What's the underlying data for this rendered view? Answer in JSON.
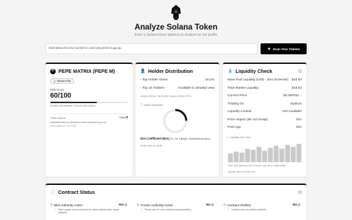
{
  "header": {
    "title": "Analyze Solana Token",
    "subtitle": "Enter a Solana token address to analyze its risk profile"
  },
  "search": {
    "value": "B8ZkNHN4k5SoYAeJ3bHS5FGrLUWhYpKy9DDSC5ugpump",
    "button_label": "Scan Your Tokens"
  },
  "token_card": {
    "name": "PEPE MATRIX (PEPE M)",
    "risk_badge": "Medium Risk",
    "risk_score_label": "Risk Score",
    "risk_score": "60/100",
    "risk_fraction": 0.6,
    "risk_note": "Medium risk detected. Proceed with caution.",
    "address_label": "Token Address",
    "copy_label": "Copy",
    "address": "B8ZkNHN4k5SoYAeJ3bHS5FGrLUWhYpKy9DDSC5ugpump",
    "created": "Data created on 3.12 10:48"
  },
  "holder_card": {
    "title": "Holder Distribution",
    "top_holder_label": "Top Holder Owns",
    "top_holder_value": "24.5%",
    "top10_label": "Top 10 Holders",
    "top10_value": "Available in detailed view",
    "method": "Analysis Method: Top Holder Snapshot (Helius RPC)",
    "dist_label": "Wallet Distribution",
    "gini_label": "Gini Coefficient (Est.):",
    "gini_value": "0.72 (High Concentration)",
    "note": "Holder data via Apollo",
    "donut_fraction": 0.245
  },
  "liquidity_card": {
    "title": "Liquidity Check",
    "rows": [
      {
        "k": "Main Pool Liquidity (USD - Dex Screener)",
        "v": "$16.83"
      },
      {
        "k": "Total Market Liquidity",
        "v": "$16.83"
      },
      {
        "k": "Current Price",
        "v": "$0.000031..."
      },
      {
        "k": "Trading On",
        "v": "raydium"
      },
      {
        "k": "Liquidity Locked",
        "v": "Not Available"
      },
      {
        "k": "Price Impact (5K Sol Swap)",
        "v": "N/A"
      },
      {
        "k": "Pool Age",
        "v": "N/A"
      }
    ],
    "chart_label": "Liquidity Over Time",
    "note": "Note: USD data from Dex Screener may have a slight delay.",
    "note2": "Liquidity data via DexScreen",
    "bars": [
      0.45,
      0.55,
      0.5,
      0.7,
      0.65,
      0.8,
      0.6,
      0.75,
      0.85,
      0.7,
      0.9,
      0.8,
      0.95
    ]
  },
  "contract_card": {
    "title": "Contract Status",
    "items": [
      {
        "title": "Mint Authority Active",
        "value": "Yes",
        "desc": "Token supply can be increased by creator (Allows future supply changes)"
      },
      {
        "title": "Freeze Authority Active",
        "value": "No",
        "desc": "Tokens can't be frozen (Allows trading transfers)"
      },
      {
        "title": "Contract Verified",
        "value": "No",
        "desc": "Contract code not publicly available"
      }
    ]
  }
}
